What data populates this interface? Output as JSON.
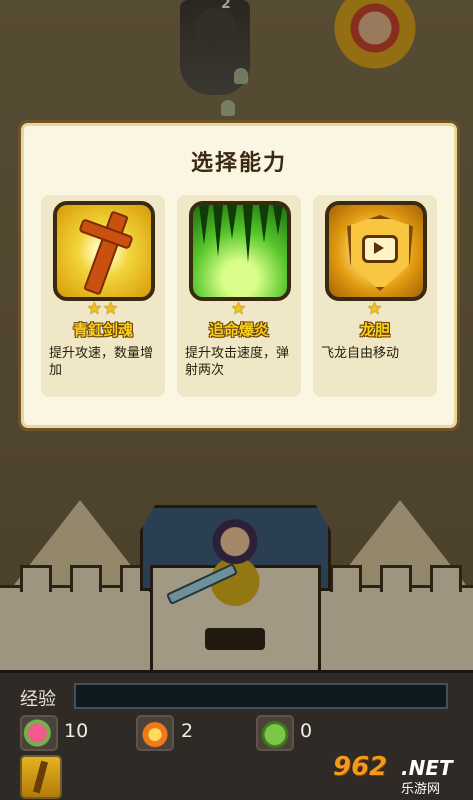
{
  "modal": {
    "title": "选择能力",
    "cards": [
      {
        "stars": "★★",
        "name": "青釭剑魂",
        "description": "提升攻速，数量增加",
        "icon": "golden-sword-icon"
      },
      {
        "stars": "★",
        "name": "追命爆炎",
        "description": "提升攻击速度，弹射两次",
        "icon": "green-burst-icon"
      },
      {
        "stars": "★",
        "name": "龙胆",
        "description": "飞龙自由移动",
        "icon": "video-shield-icon"
      }
    ]
  },
  "hud": {
    "exp_label": "经验",
    "exp_progress": 0,
    "resources": [
      {
        "icon": "flower-icon",
        "value": "10"
      },
      {
        "icon": "fire-icon",
        "value": "2"
      },
      {
        "icon": "tank-icon",
        "value": "0"
      }
    ],
    "item_slot_icon": "sword-item-icon"
  },
  "enemy_label": "2",
  "watermark": {
    "number": "962",
    "suffix": ".NET",
    "site": "乐游网"
  },
  "colors": {
    "accent_gold": "#f7d21b",
    "modal_bg": "#fbf6e4",
    "hud_bg": "#2f2a25"
  }
}
